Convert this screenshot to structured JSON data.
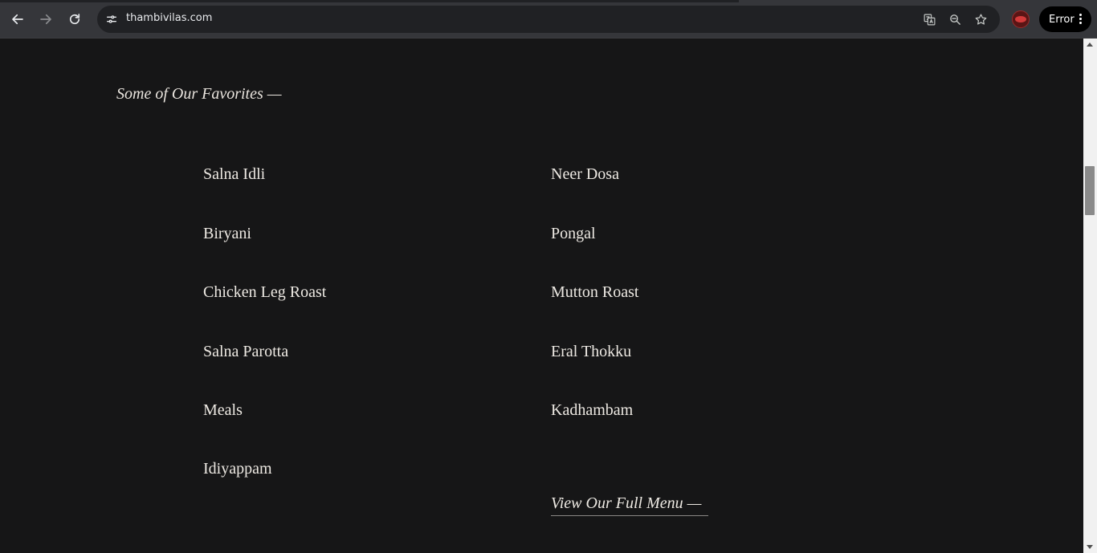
{
  "browser": {
    "url": "thambivilas.com",
    "error_label": "Error",
    "icons": [
      "back-arrow-icon",
      "forward-arrow-icon",
      "reload-icon",
      "site-info-icon",
      "translate-icon",
      "zoom-icon",
      "star-icon",
      "kebab-menu-icon"
    ]
  },
  "page": {
    "section_heading": "Some of Our Favorites —",
    "left_items": [
      "Salna Idli",
      "Biryani",
      "Chicken Leg Roast",
      "Salna Parotta",
      "Meals",
      "Idiyappam"
    ],
    "right_items": [
      "Neer Dosa",
      "Pongal",
      "Mutton Roast",
      "Eral Thokku",
      "Kadhambam"
    ],
    "full_menu_link": "View Our Full Menu —"
  },
  "scrollbar": {
    "position_fraction": 0.2
  },
  "colors": {
    "page_bg": "#161617",
    "text": "#ede9e3",
    "browser_bar": "#35363a",
    "omnibox": "#202124"
  }
}
